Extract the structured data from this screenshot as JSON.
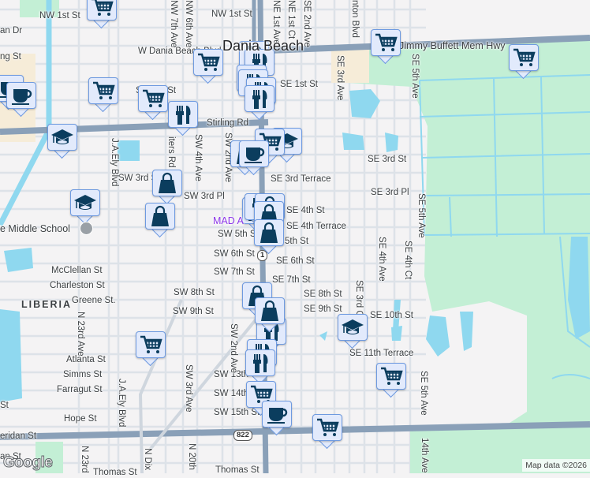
{
  "map": {
    "town_label": "Dania Beach",
    "neighborhood_label": "LIBERIA",
    "poi_label": "MAD A",
    "school_label": "e Middle School",
    "route_shields": [
      "1",
      "822"
    ],
    "attribution": "Map data ©2026",
    "logo": "Google",
    "street_labels": [
      "NW 1st St",
      "NW 1st St",
      "an Dr",
      "ng St",
      "W Dania Beach Blvd",
      "SE 1st St",
      "SW 1st St",
      "Stirling Rd",
      "SW 3rd St",
      "SE 3rd Terrace",
      "SE 3rd St",
      "SE 3rd Pl",
      "SW 3rd Pl",
      "SE 4th St",
      "SE 4th Terrace",
      "SW 5th St",
      "5th St",
      "SW 6th St",
      "SE 6th St",
      "McClellan St",
      "Charleston St",
      "SW 7th St",
      "SE 7th St",
      "Greene St.",
      "SW 8th St",
      "SE 8th St",
      "SW 9th St",
      "SE 9th St",
      "SE 10th St",
      "SE 11th Terrace",
      "Atlanta St",
      "Simms St",
      "SW 13th St",
      "Farragut St",
      "SW 14th St",
      "St",
      "SW 15th St",
      "Hope St",
      "eridan St",
      "Thomas St",
      "Thomas St",
      "an St",
      "Jimmy Buffett Mem Hwy"
    ],
    "avenue_labels": [
      "NW 7th Ave",
      "NW 6th Ave",
      "NE 1st Ave",
      "NE 1st Ct",
      "SE 2nd Ave",
      "nton Blvd",
      "SE 3rd Ave",
      "SE 5th Ave",
      "SE 5th Ave",
      "SE 5th Ave",
      "14th Ave",
      "J.A.Ely Blvd",
      "J.A.Ely Blvd",
      "iters Rd",
      "SW 4th Ave",
      "SW 2nd Ave",
      "SW 2nd Ave",
      "SW 3rd Ave",
      "N 23rd Ave",
      "N 23rd",
      "N Dix",
      "N 20th",
      "SE 3rd Ct",
      "SE 4th Ave",
      "SE 4th Ct"
    ],
    "markers": [
      "cart-icon",
      "cart-icon",
      "coffee-icon",
      "coffee-icon",
      "cart-icon",
      "cart-icon",
      "fork-knife-icon",
      "graduation-cap-icon",
      "fork-knife-icon",
      "fork-knife-icon",
      "fork-knife-icon",
      "fork-knife-icon",
      "fork-knife-icon",
      "fork-knife-icon",
      "graduation-cap-icon",
      "cart-icon",
      "bag-icon",
      "coffee-icon",
      "bag-icon",
      "graduation-cap-icon",
      "bag-icon",
      "fork-knife-icon",
      "bag-icon",
      "bag-icon",
      "bag-icon",
      "bag-icon",
      "fork-knife-icon",
      "fork-knife-icon",
      "fork-knife-icon",
      "cart-icon",
      "coffee-icon",
      "cart-icon",
      "cart-icon",
      "cart-icon",
      "graduation-cap-icon",
      "cart-icon",
      "cart-icon"
    ],
    "colors": {
      "road_major": "#8aa0b8",
      "road_minor": "#dde2e8",
      "park": "#c3efd5",
      "water": "#8fd8ef",
      "marker_fill": "#e2eafc",
      "marker_border": "#6e9ae0",
      "icon": "#0b3d5e"
    }
  }
}
